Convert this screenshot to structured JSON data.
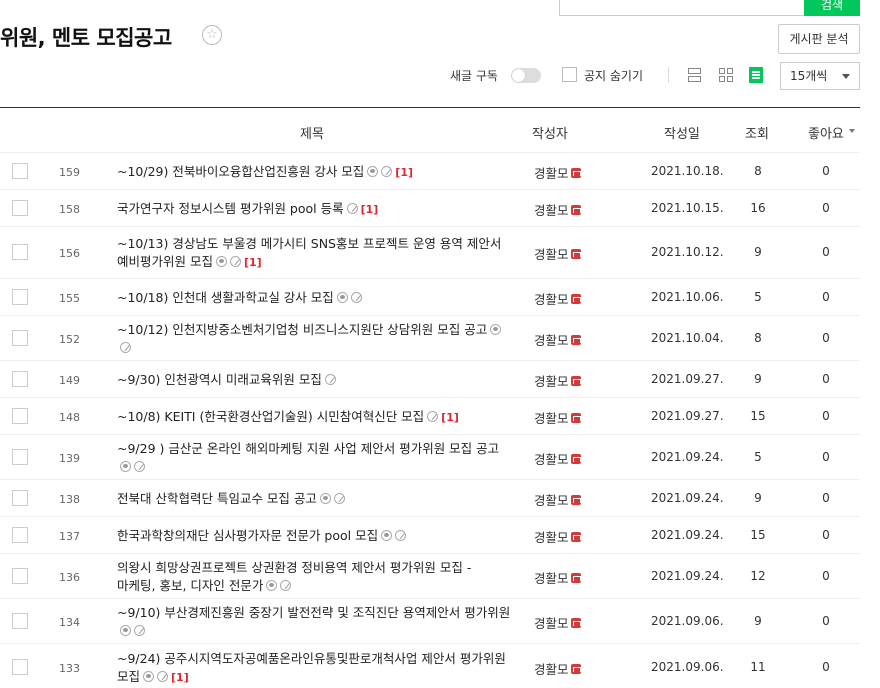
{
  "search": {
    "button_label": "검색"
  },
  "board": {
    "title": "위원, 멘토 모집공고",
    "star_icon": "star-icon",
    "analysis_label": "게시판 분석"
  },
  "toolbar": {
    "subscribe_label": "새글 구독",
    "hide_notice_label": "공지 숨기기",
    "page_size": "15개씩"
  },
  "columns": {
    "title": "제목",
    "author": "작성자",
    "date": "작성일",
    "views": "조회",
    "likes": "좋아요"
  },
  "colors": {
    "accent": "#03c75a",
    "comment": "#e0282d",
    "badge": "#d23b3b"
  },
  "rows": [
    {
      "num": "159",
      "title": "~10/29) 전북바이오융합산업진흥원 강사 모집",
      "icons": [
        "img",
        "att"
      ],
      "comments": "[1]",
      "author": "경활모",
      "date": "2021.10.18.",
      "views": "8",
      "likes": "0"
    },
    {
      "num": "158",
      "title": "국가연구자 정보시스템 평가위원 pool 등록",
      "icons": [
        "att"
      ],
      "comments": "[1]",
      "author": "경활모",
      "date": "2021.10.15.",
      "views": "16",
      "likes": "0"
    },
    {
      "num": "156",
      "title": "~10/13) 경상남도 부울경 메가시티 SNS홍보 프로젝트 운영 용역 제안서 예비평가위원 모집",
      "icons": [
        "img",
        "att"
      ],
      "comments": "[1]",
      "author": "경활모",
      "date": "2021.10.12.",
      "views": "9",
      "likes": "0"
    },
    {
      "num": "155",
      "title": "~10/18) 인천대 생활과학교실 강사 모집",
      "icons": [
        "img",
        "att"
      ],
      "comments": "",
      "author": "경활모",
      "date": "2021.10.06.",
      "views": "5",
      "likes": "0"
    },
    {
      "num": "152",
      "title": "~10/12) 인천지방중소벤처기업청 비즈니스지원단 상담위원 모집 공고",
      "icons": [
        "img",
        "att"
      ],
      "comments": "",
      "author": "경활모",
      "date": "2021.10.04.",
      "views": "8",
      "likes": "0"
    },
    {
      "num": "149",
      "title": "~9/30) 인천광역시 미래교육위원 모집",
      "icons": [
        "att"
      ],
      "comments": "",
      "author": "경활모",
      "date": "2021.09.27.",
      "views": "9",
      "likes": "0"
    },
    {
      "num": "148",
      "title": "~10/8) KEITI (한국환경산업기술원) 시민참여혁신단 모집",
      "icons": [
        "att"
      ],
      "comments": "[1]",
      "author": "경활모",
      "date": "2021.09.27.",
      "views": "15",
      "likes": "0"
    },
    {
      "num": "139",
      "title": "~9/29 ) 금산군 온라인 해외마케팅 지원 사업 제안서 평가위원 모집 공고",
      "icons": [
        "img",
        "att"
      ],
      "comments": "",
      "author": "경활모",
      "date": "2021.09.24.",
      "views": "5",
      "likes": "0"
    },
    {
      "num": "138",
      "title": "전북대 산학협력단 특임교수 모집 공고",
      "icons": [
        "img",
        "att"
      ],
      "comments": "",
      "author": "경활모",
      "date": "2021.09.24.",
      "views": "9",
      "likes": "0"
    },
    {
      "num": "137",
      "title": "한국과학창의재단 심사평가자문 전문가 pool 모집",
      "icons": [
        "img",
        "att"
      ],
      "comments": "",
      "author": "경활모",
      "date": "2021.09.24.",
      "views": "15",
      "likes": "0"
    },
    {
      "num": "136",
      "title": "의왕시 희망상권프로젝트 상권환경 정비용역 제안서 평가위원 모집 - 마케팅, 홍보, 디자인 전문가",
      "icons": [
        "img",
        "att"
      ],
      "comments": "",
      "author": "경활모",
      "date": "2021.09.24.",
      "views": "12",
      "likes": "0"
    },
    {
      "num": "134",
      "title": "~9/10) 부산경제진흥원 중장기 발전전략 및 조직진단 용역제안서 평가위원",
      "icons": [
        "img",
        "att"
      ],
      "comments": "",
      "author": "경활모",
      "date": "2021.09.06.",
      "views": "9",
      "likes": "0"
    },
    {
      "num": "133",
      "title": "~9/24) 공주시지역도자공예품온라인유통및판로개척사업 제안서 평가위원 모집",
      "icons": [
        "img",
        "att"
      ],
      "comments": "[1]",
      "author": "경활모",
      "date": "2021.09.06.",
      "views": "11",
      "likes": "0"
    }
  ]
}
